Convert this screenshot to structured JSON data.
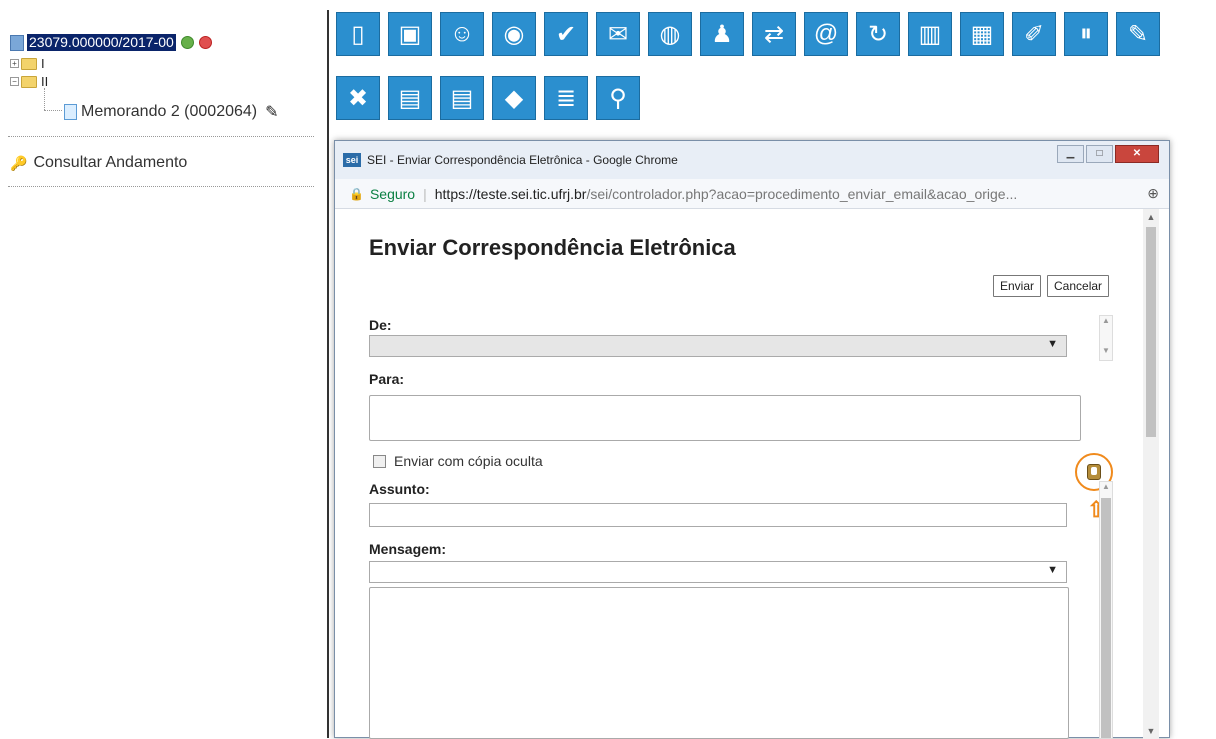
{
  "tree": {
    "process_number": "23079.000000/2017-00",
    "folder_1": "I",
    "folder_2": "II",
    "document": "Memorando 2 (0002064)",
    "consult": "Consultar Andamento"
  },
  "toolbar": {
    "row1": [
      "new-document-icon",
      "sei-edit-icon",
      "users-icon",
      "eye-icon",
      "thumbs-up-icon",
      "mail-document-icon",
      "globe-send-icon",
      "person-folder-icon",
      "document-move-icon",
      "email-icon",
      "refresh-icon",
      "books-icon",
      "building-person-icon",
      "clipboard-icon",
      "pause-icon",
      "signature-icon"
    ],
    "row2": [
      "delete-document-icon",
      "pdf-icon",
      "zip-icon",
      "tag-icon",
      "list-icon",
      "search-icon"
    ]
  },
  "window": {
    "logo": "sei",
    "title": "SEI - Enviar Correspondência Eletrônica - Google Chrome",
    "secure_label": "Seguro",
    "url_host": "https://teste.sei.tic.ufrj.br",
    "url_rest": "/sei/controlador.php?acao=procedimento_enviar_email&acao_orige..."
  },
  "form": {
    "title": "Enviar Correspondência Eletrônica",
    "send_label": "Enviar",
    "cancel_label": "Cancelar",
    "de_label": "De:",
    "para_label": "Para:",
    "bcc_label": "Enviar com cópia oculta",
    "assunto_label": "Assunto:",
    "mensagem_label": "Mensagem:"
  },
  "colors": {
    "toolbar_blue": "#2b8fcf",
    "highlight": "#f08a1c",
    "selection": "#0a246a"
  }
}
